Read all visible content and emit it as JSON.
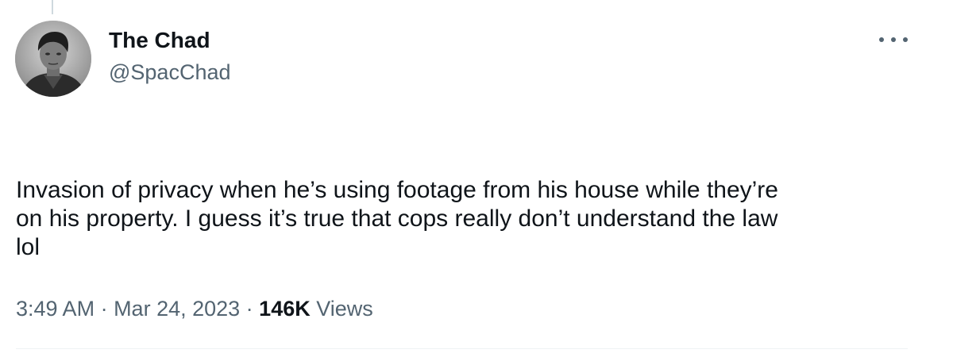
{
  "author": {
    "display_name": "The Chad",
    "handle": "@SpacChad"
  },
  "more_icon": "more-horizontal-icon",
  "tweet": {
    "text": "Invasion of privacy when he’s using footage from his house while they’re\non his property. I guess it’s true that cops really don’t understand the law\nlol"
  },
  "meta": {
    "time": "3:49 AM",
    "separator": " · ",
    "date": "Mar 24, 2023",
    "views_count": "146K",
    "views_label": " Views"
  },
  "colors": {
    "text_primary": "#0f1419",
    "text_secondary": "#536471",
    "divider": "#eff3f4"
  }
}
